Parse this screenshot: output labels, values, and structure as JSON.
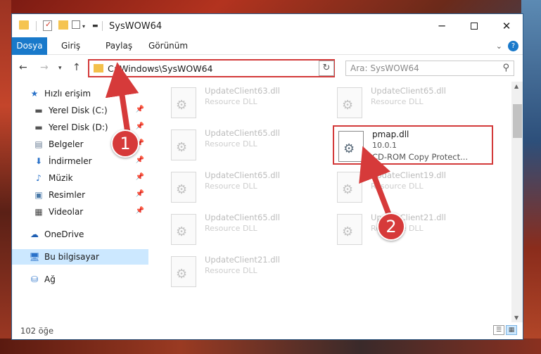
{
  "window": {
    "title": "SysWOW64"
  },
  "ribbon": {
    "tabs": [
      "Dosya",
      "Giriş",
      "Paylaş",
      "Görünüm"
    ]
  },
  "address": {
    "path": "C:\\Windows\\SysWOW64"
  },
  "search": {
    "placeholder": "Ara: SysWOW64"
  },
  "sidebar": {
    "items": [
      {
        "label": "Hızlı erişim",
        "icon": "star-icon"
      },
      {
        "label": "Yerel Disk (C:)",
        "icon": "drive-icon",
        "pinned": true
      },
      {
        "label": "Yerel Disk (D:)",
        "icon": "drive-icon",
        "pinned": true
      },
      {
        "label": "Belgeler",
        "icon": "documents-icon",
        "pinned": true
      },
      {
        "label": "İndirmeler",
        "icon": "download-icon",
        "pinned": true
      },
      {
        "label": "Müzik",
        "icon": "music-icon",
        "pinned": true
      },
      {
        "label": "Resimler",
        "icon": "pictures-icon",
        "pinned": true
      },
      {
        "label": "Videolar",
        "icon": "videos-icon",
        "pinned": true
      },
      {
        "label": "OneDrive",
        "icon": "cloud-icon"
      },
      {
        "label": "Bu bilgisayar",
        "icon": "computer-icon",
        "selected": true
      },
      {
        "label": "Ağ",
        "icon": "network-icon"
      }
    ]
  },
  "files": [
    {
      "name": "UpdateClient63.dll",
      "type": "Resource DLL"
    },
    {
      "name": "UpdateClient65.dll",
      "type": "Resource DLL"
    },
    {
      "name": "UpdateClient65.dll",
      "type": "Resource DLL"
    },
    {
      "name": "pmap.dll",
      "version": "10.0.1",
      "desc": "CD-ROM Copy Protect...",
      "highlighted": true
    },
    {
      "name": "UpdateClient65.dll",
      "type": "Resource DLL"
    },
    {
      "name": "UpdateClient19.dll",
      "type": "Resource DLL"
    },
    {
      "name": "UpdateClient65.dll",
      "type": "Resource DLL"
    },
    {
      "name": "UpdateClient21.dll",
      "type": "Resource DLL"
    },
    {
      "name": "UpdateClient21.dll",
      "type": "Resource DLL"
    }
  ],
  "status": {
    "count": "102 öğe"
  },
  "annotations": {
    "step1": "1",
    "step2": "2"
  },
  "colors": {
    "accent": "#1979ca",
    "highlight": "#d33a3a"
  }
}
